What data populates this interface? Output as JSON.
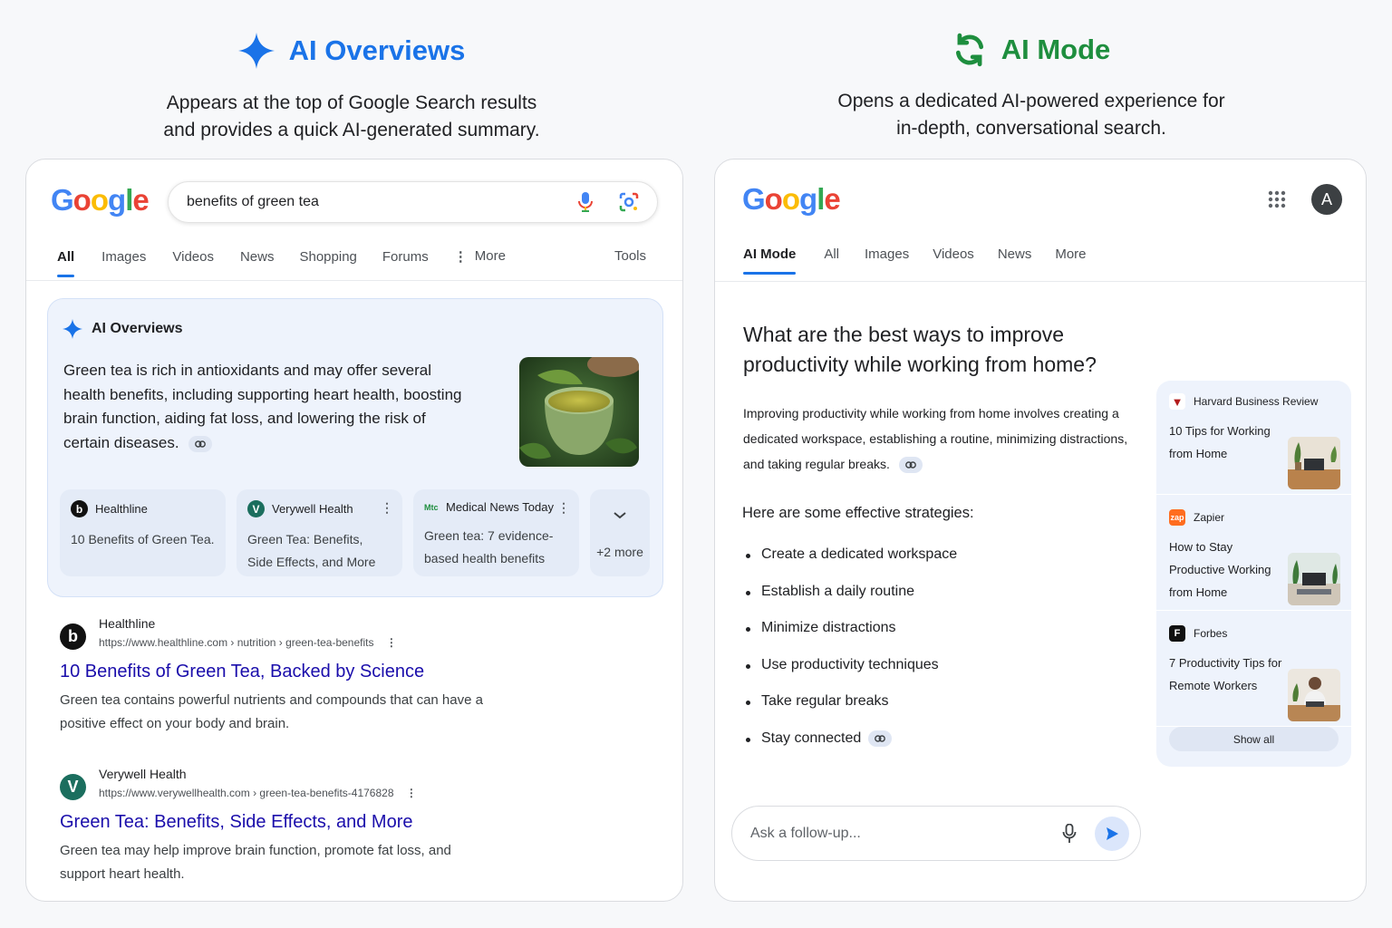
{
  "left_header": {
    "title": "AI Overviews",
    "subtitle": "Appears at the top of Google Search results\nand provides a quick AI-generated summary."
  },
  "right_header": {
    "title": "AI Mode",
    "subtitle": "Opens a dedicated AI-powered experience for\nin-depth, conversational search."
  },
  "logo_letters": [
    "G",
    "o",
    "o",
    "g",
    "l",
    "e"
  ],
  "left_panel": {
    "search_value": "benefits of green tea",
    "tabs": [
      "All",
      "Images",
      "Videos",
      "News",
      "Shopping",
      "Forums",
      "More"
    ],
    "tools": "Tools",
    "ai_overview": {
      "heading": "AI Overviews",
      "text": "Green tea is rich in antioxidants and may offer several health benefits, including supporting heart health, boosting brain function, aiding fat loss, and lowering the risk of certain diseases.",
      "sources": [
        {
          "name": "Healthline",
          "title": "10 Benefits of Green Tea."
        },
        {
          "name": "Verywell Health",
          "title": "Green Tea: Benefits, Side Effects, and More"
        },
        {
          "name": "Medical News Today",
          "title": "Green tea: 7 evidence-based health benefits"
        }
      ],
      "more": "+2 more"
    },
    "results": [
      {
        "site": "Healthline",
        "url": "https://www.healthline.com › nutrition › green-tea-benefits",
        "title": "10 Benefits of Green Tea, Backed by Science",
        "snippet": "Green tea contains powerful nutrients and compounds that can have a positive effect on your body and brain."
      },
      {
        "site": "Verywell Health",
        "url": "https://www.verywellhealth.com › green-tea-benefits-4176828",
        "title": "Green Tea: Benefits, Side Effects, and More",
        "snippet": "Green tea may help improve brain function, promote fat loss, and support heart health."
      }
    ]
  },
  "right_panel": {
    "avatar_letter": "A",
    "tabs": [
      "AI Mode",
      "All",
      "Images",
      "Videos",
      "News",
      "More"
    ],
    "question": "What are the best ways to improve productivity while working from home?",
    "answer": "Improving productivity while working from home involves creating a dedicated workspace, establishing a routine, minimizing distractions, and taking regular breaks.",
    "strategies_heading": "Here are some effective strategies:",
    "strategies": [
      "Create a dedicated workspace",
      "Establish a daily routine",
      "Minimize distractions",
      "Use productivity techniques",
      "Take regular breaks",
      "Stay connected"
    ],
    "source_cards": [
      {
        "name": "Harvard Business Review",
        "title": "10 Tips for Working from Home",
        "badge": "▼"
      },
      {
        "name": "Zapier",
        "title": "How to Stay Productive Working from Home",
        "badge": "zap"
      },
      {
        "name": "Forbes",
        "title": "7 Productivity Tips for Remote Workers",
        "badge": "F"
      }
    ],
    "show_all": "Show all",
    "followup_placeholder": "Ask a follow-up..."
  },
  "colors": {
    "ai_overviews_blue": "#1a73e8",
    "ai_mode_green": "#1e8e3e",
    "link_blue": "#1a0dab"
  },
  "icons": [
    "sparkle-icon",
    "refresh-cycle-icon",
    "mic-icon",
    "lens-icon",
    "kebab-icon",
    "apps-grid-icon",
    "link-icon",
    "chevron-down-icon",
    "send-icon"
  ]
}
